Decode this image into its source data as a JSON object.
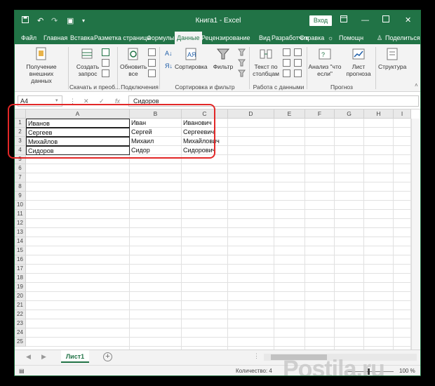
{
  "titlebar": {
    "doc_title": "Книга1  -  Excel",
    "signin": "Вход",
    "qa_icons": [
      "save-icon",
      "undo-icon",
      "redo-icon",
      "camera-icon",
      "customize-icon"
    ],
    "win_icons": [
      "ribbon-options-icon",
      "minimize-icon",
      "maximize-icon",
      "close-icon"
    ]
  },
  "menu": {
    "tabs": [
      "Файл",
      "Главная",
      "Вставка",
      "Разметка страницы",
      "Формулы",
      "Данные",
      "Рецензирование",
      "Вид",
      "Разработчик",
      "Справка"
    ],
    "active": "Данные",
    "help": "Помощн",
    "share": "Поделиться"
  },
  "ribbon": {
    "get_data": "Получение внешних данных",
    "create_query": "Создать запрос",
    "refresh_all": "Обновить все",
    "sort": "Сортировка",
    "filter": "Фильтр",
    "text_to_columns": "Текст по столбцам",
    "what_if": "Анализ \"что если\"",
    "forecast_sheet": "Лист прогноза",
    "outline": "Структура",
    "groups": {
      "download": "Скачать и преоб...",
      "connections": "Подключения",
      "sort_filter": "Сортировка и фильтр",
      "data_tools": "Работа с данными",
      "forecast": "Прогноз"
    }
  },
  "formula_bar": {
    "name_box": "A4",
    "fx": "fx",
    "value": "Сидоров"
  },
  "columns": [
    "A",
    "B",
    "C",
    "D",
    "E",
    "F",
    "G",
    "H",
    "I"
  ],
  "rows": [
    "1",
    "2",
    "3",
    "4",
    "5",
    "6",
    "7",
    "8",
    "9",
    "10",
    "11",
    "12",
    "13",
    "14",
    "15",
    "16",
    "17",
    "18",
    "19",
    "20",
    "21",
    "22",
    "23",
    "24",
    "25"
  ],
  "cells": [
    [
      "Иванов",
      "Иван",
      "Иванович"
    ],
    [
      "Сергеев",
      "Сергей",
      "Сергеевич"
    ],
    [
      "Михайлов",
      "Михаил",
      "Михайлович"
    ],
    [
      "Сидоров",
      "Сидор",
      "Сидорович"
    ]
  ],
  "sheet_tab": "Лист1",
  "status": {
    "count": "Количество: 4",
    "zoom": "100 %"
  },
  "watermark": "Postila.ru"
}
